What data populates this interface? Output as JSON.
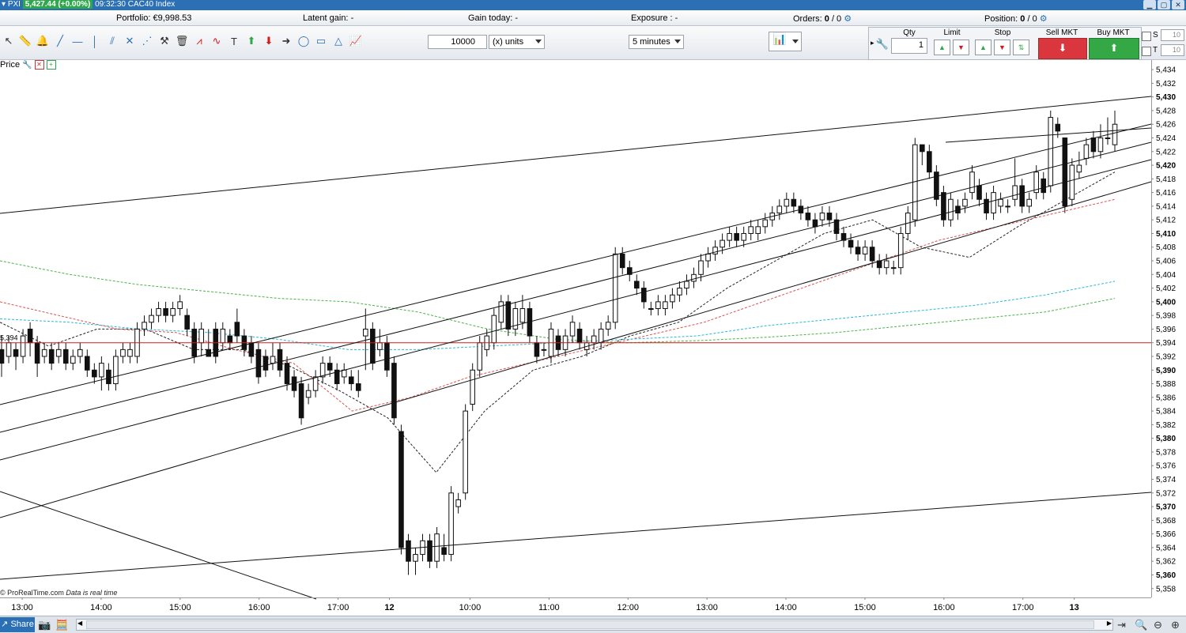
{
  "titlebar": {
    "app": "PXI",
    "price": "5,427.44 (+0.00%)",
    "time": "09:32:30",
    "instrument": "CAC40 Index"
  },
  "statusbar": {
    "portfolio_label": "Portfolio:",
    "portfolio_value": "€9,998.53",
    "latent_label": "Latent gain:",
    "latent_value": "-",
    "gain_today_label": "Gain today:",
    "gain_today_value": "-",
    "exposure_label": "Exposure :",
    "exposure_value": "-",
    "orders_label": "Orders:",
    "orders_value": "0",
    "orders_slash": "/ 0",
    "position_label": "Position:",
    "position_value": "0",
    "position_slash": "/ 0"
  },
  "toolbar": {
    "quantity": "10000",
    "units": "(x) units",
    "interval": "5 minutes"
  },
  "order_panel": {
    "qty_label": "Qty",
    "qty_value": "1",
    "limit_label": "Limit",
    "stop_label": "Stop",
    "sell_label": "Sell MKT",
    "buy_label": "Buy MKT",
    "s_label": "S",
    "s_value": "10",
    "t_label": "T",
    "t_value": "10"
  },
  "chart_header": {
    "label": "Price"
  },
  "watermark": {
    "brand": "© ProRealTime.com",
    "note": "Data is real time"
  },
  "bottom": {
    "share_label": "Share"
  },
  "colors": {
    "accent": "#2b6fb5",
    "sell": "#d9363e",
    "buy": "#33a845",
    "ref_line": "#d11b1b"
  },
  "chart_data": {
    "type": "candlestick",
    "instrument": "CAC40 Index",
    "interval": "5 minutes",
    "ylim": [
      5356.7,
      5435.4
    ],
    "y_ticks": [
      5434,
      5432,
      5430,
      5428,
      5426,
      5424,
      5422,
      5420,
      5418,
      5416,
      5414,
      5412,
      5410,
      5408,
      5406,
      5404,
      5402,
      5400,
      5398,
      5396,
      5394,
      5392,
      5390,
      5388,
      5386,
      5384,
      5382,
      5380,
      5378,
      5376,
      5374,
      5372,
      5370,
      5368,
      5366,
      5364,
      5362,
      5360,
      5358
    ],
    "y_ticks_bold": [
      5430,
      5420,
      5410,
      5400,
      5390,
      5380,
      5370,
      5360
    ],
    "x_ticks": [
      {
        "label": "13:00",
        "x": 0.0
      },
      {
        "label": "14:00",
        "x": 1.0
      },
      {
        "label": "15:00",
        "x": 2.0
      },
      {
        "label": "16:00",
        "x": 3.0
      },
      {
        "label": "17:00",
        "x": 4.0
      },
      {
        "label": "12",
        "x": 4.65,
        "bold": true
      },
      {
        "label": "10:00",
        "x": 5.67
      },
      {
        "label": "11:00",
        "x": 6.67
      },
      {
        "label": "12:00",
        "x": 7.67
      },
      {
        "label": "13:00",
        "x": 8.67
      },
      {
        "label": "14:00",
        "x": 9.67
      },
      {
        "label": "15:00",
        "x": 10.67
      },
      {
        "label": "16:00",
        "x": 11.67
      },
      {
        "label": "17:00",
        "x": 12.67
      },
      {
        "label": "13",
        "x": 13.32,
        "bold": true
      }
    ],
    "reference_line": {
      "value": 5394,
      "label": "5,394"
    },
    "candles": [
      [
        5393,
        5391,
        5395,
        5389
      ],
      [
        5392,
        5394,
        5395,
        5391
      ],
      [
        5393,
        5392,
        5394,
        5390
      ],
      [
        5392,
        5395,
        5396,
        5391
      ],
      [
        5396,
        5394,
        5397,
        5392
      ],
      [
        5394,
        5391,
        5395,
        5389
      ],
      [
        5392,
        5393,
        5394,
        5391
      ],
      [
        5393,
        5391,
        5394,
        5390
      ],
      [
        5392,
        5393,
        5394,
        5391
      ],
      [
        5393,
        5391,
        5394,
        5390
      ],
      [
        5391,
        5392,
        5393,
        5390
      ],
      [
        5392,
        5393,
        5394,
        5391
      ],
      [
        5392,
        5390,
        5393,
        5389
      ],
      [
        5390,
        5389,
        5391,
        5388
      ],
      [
        5389,
        5391,
        5392,
        5387
      ],
      [
        5390,
        5388,
        5391,
        5387
      ],
      [
        5388,
        5392,
        5393,
        5387
      ],
      [
        5392,
        5393,
        5394,
        5391
      ],
      [
        5392,
        5393,
        5394,
        5391
      ],
      [
        5392,
        5396,
        5397,
        5391
      ],
      [
        5396,
        5397,
        5398,
        5395
      ],
      [
        5397,
        5398,
        5399,
        5396
      ],
      [
        5398,
        5399,
        5400,
        5397
      ],
      [
        5399,
        5398,
        5400,
        5397
      ],
      [
        5398,
        5399,
        5400,
        5397
      ],
      [
        5399,
        5400,
        5401,
        5398
      ],
      [
        5398,
        5396,
        5399,
        5395
      ],
      [
        5396,
        5392,
        5397,
        5391
      ],
      [
        5394,
        5396,
        5397,
        5392
      ],
      [
        5393,
        5392,
        5396,
        5392
      ],
      [
        5396,
        5392,
        5397,
        5391
      ],
      [
        5394,
        5396,
        5397,
        5393
      ],
      [
        5395,
        5394,
        5396,
        5393
      ],
      [
        5397,
        5395,
        5399,
        5394
      ],
      [
        5395,
        5393,
        5396,
        5392
      ],
      [
        5394,
        5392,
        5395,
        5391
      ],
      [
        5393,
        5389,
        5394,
        5388
      ],
      [
        5392,
        5390,
        5393,
        5389
      ],
      [
        5391,
        5392,
        5394,
        5390
      ],
      [
        5393,
        5390,
        5394,
        5389
      ],
      [
        5391,
        5388,
        5392,
        5387
      ],
      [
        5389,
        5387,
        5390,
        5386
      ],
      [
        5388,
        5383,
        5389,
        5382
      ],
      [
        5386,
        5387,
        5388,
        5385
      ],
      [
        5387,
        5389,
        5390,
        5386
      ],
      [
        5389,
        5391,
        5392,
        5388
      ],
      [
        5391,
        5390,
        5392,
        5389
      ],
      [
        5390,
        5388,
        5391,
        5387
      ],
      [
        5389,
        5390,
        5391,
        5388
      ],
      [
        5389,
        5388,
        5390,
        5387
      ],
      [
        5388,
        5387,
        5390,
        5386
      ],
      [
        5395,
        5396,
        5399,
        5390
      ],
      [
        5396,
        5391,
        5397,
        5390
      ],
      [
        5393,
        5394,
        5396,
        5392
      ],
      [
        5394,
        5390,
        5395,
        5389
      ],
      [
        5391,
        5383,
        5392,
        5382
      ],
      [
        5381,
        5364,
        5382,
        5363
      ],
      [
        5365,
        5362,
        5366,
        5360
      ],
      [
        5362,
        5363,
        5364,
        5360
      ],
      [
        5363,
        5365,
        5366,
        5362
      ],
      [
        5365,
        5362,
        5366,
        5361
      ],
      [
        5362,
        5366,
        5367,
        5361
      ],
      [
        5364,
        5363,
        5366,
        5362
      ],
      [
        5363,
        5372,
        5373,
        5362
      ],
      [
        5370,
        5371,
        5372,
        5369
      ],
      [
        5372,
        5384,
        5385,
        5371
      ],
      [
        5385,
        5390,
        5391,
        5384
      ],
      [
        5390,
        5394,
        5395,
        5389
      ],
      [
        5393,
        5395,
        5396,
        5392
      ],
      [
        5394,
        5398,
        5399,
        5393
      ],
      [
        5397,
        5400,
        5401,
        5396
      ],
      [
        5400,
        5396,
        5401,
        5395
      ],
      [
        5396,
        5399,
        5400,
        5395
      ],
      [
        5397,
        5399,
        5401,
        5396
      ],
      [
        5399,
        5395,
        5400,
        5394
      ],
      [
        5394,
        5392,
        5395,
        5391
      ],
      [
        5393,
        5393,
        5394,
        5392
      ],
      [
        5392,
        5396,
        5397,
        5391
      ],
      [
        5395,
        5393,
        5396,
        5392
      ],
      [
        5393,
        5395,
        5396,
        5392
      ],
      [
        5395,
        5397,
        5398,
        5394
      ],
      [
        5396,
        5394,
        5397,
        5393
      ],
      [
        5393,
        5394,
        5395,
        5392
      ],
      [
        5394,
        5395,
        5396,
        5393
      ],
      [
        5394,
        5396,
        5397,
        5393
      ],
      [
        5396,
        5397,
        5398,
        5395
      ],
      [
        5397,
        5407,
        5408,
        5396
      ],
      [
        5407,
        5405,
        5408,
        5404
      ],
      [
        5405,
        5404,
        5406,
        5403
      ],
      [
        5403,
        5402,
        5404,
        5401
      ],
      [
        5402,
        5400,
        5403,
        5399
      ],
      [
        5399,
        5399,
        5400,
        5398
      ],
      [
        5399,
        5400,
        5401,
        5398
      ],
      [
        5399,
        5400,
        5401,
        5398
      ],
      [
        5400,
        5401,
        5402,
        5399
      ],
      [
        5401,
        5402,
        5403,
        5400
      ],
      [
        5402,
        5403,
        5404,
        5401
      ],
      [
        5403,
        5404,
        5405,
        5402
      ],
      [
        5404,
        5406,
        5407,
        5403
      ],
      [
        5406,
        5407,
        5408,
        5405
      ],
      [
        5407,
        5408,
        5409,
        5406
      ],
      [
        5408,
        5409,
        5410,
        5407
      ],
      [
        5409,
        5410,
        5411,
        5408
      ],
      [
        5410,
        5409,
        5411,
        5408
      ],
      [
        5409,
        5410,
        5411,
        5408
      ],
      [
        5410,
        5411,
        5412,
        5409
      ],
      [
        5410,
        5411,
        5412,
        5409
      ],
      [
        5411,
        5412,
        5413,
        5410
      ],
      [
        5412,
        5413,
        5414,
        5411
      ],
      [
        5413,
        5414,
        5415,
        5412
      ],
      [
        5414,
        5415,
        5416,
        5413
      ],
      [
        5415,
        5414,
        5416,
        5413
      ],
      [
        5414,
        5413,
        5415,
        5412
      ],
      [
        5413,
        5412,
        5414,
        5411
      ],
      [
        5412,
        5411,
        5413,
        5410
      ],
      [
        5412,
        5413,
        5414,
        5411
      ],
      [
        5413,
        5412,
        5414,
        5411
      ],
      [
        5412,
        5410,
        5413,
        5409
      ],
      [
        5410,
        5409,
        5411,
        5408
      ],
      [
        5409,
        5408,
        5410,
        5407
      ],
      [
        5408,
        5407,
        5409,
        5406
      ],
      [
        5407,
        5408,
        5409,
        5406
      ],
      [
        5408,
        5406,
        5409,
        5405
      ],
      [
        5406,
        5405,
        5407,
        5404
      ],
      [
        5405,
        5406,
        5407,
        5404
      ],
      [
        5405,
        5405,
        5406,
        5404
      ],
      [
        5405,
        5410,
        5411,
        5404
      ],
      [
        5410,
        5413,
        5414,
        5409
      ],
      [
        5412,
        5423,
        5424,
        5411
      ],
      [
        5423,
        5422,
        5423,
        5420
      ],
      [
        5422,
        5419,
        5423,
        5418
      ],
      [
        5419,
        5415,
        5420,
        5414
      ],
      [
        5416,
        5412,
        5417,
        5411
      ],
      [
        5412,
        5415,
        5416,
        5411
      ],
      [
        5414,
        5413,
        5415,
        5412
      ],
      [
        5414,
        5415,
        5416,
        5413
      ],
      [
        5416,
        5419,
        5420,
        5415
      ],
      [
        5417,
        5415,
        5418,
        5414
      ],
      [
        5415,
        5413,
        5416,
        5412
      ],
      [
        5413,
        5416,
        5417,
        5412
      ],
      [
        5414,
        5415,
        5416,
        5413
      ],
      [
        5414,
        5414,
        5415,
        5413
      ],
      [
        5415,
        5417,
        5421,
        5414
      ],
      [
        5417,
        5414,
        5418,
        5413
      ],
      [
        5414,
        5415,
        5416,
        5413
      ],
      [
        5416,
        5419,
        5420,
        5415
      ],
      [
        5418,
        5416,
        5419,
        5415
      ],
      [
        5417,
        5427,
        5428,
        5416
      ],
      [
        5426,
        5425,
        5427,
        5424
      ],
      [
        5424,
        5414,
        5419,
        5413
      ],
      [
        5415,
        5420,
        5421,
        5414
      ],
      [
        5419,
        5420,
        5422,
        5418
      ],
      [
        5421,
        5423,
        5424,
        5420
      ],
      [
        5424,
        5422,
        5425,
        5421
      ],
      [
        5422,
        5424,
        5426,
        5421
      ],
      [
        5424,
        5424,
        5427,
        5423
      ],
      [
        5423,
        5426,
        5428,
        5422
      ]
    ],
    "moving_averages": [
      {
        "name": "MA-black",
        "color": "#222222",
        "values": [
          [
            0,
            5397
          ],
          [
            1,
            5393.5
          ],
          [
            2,
            5396
          ],
          [
            3,
            5396
          ],
          [
            4,
            5393
          ],
          [
            5,
            5393
          ],
          [
            6,
            5390.5
          ],
          [
            7,
            5387
          ],
          [
            8,
            5383
          ],
          [
            9,
            5375
          ],
          [
            10,
            5384
          ],
          [
            11,
            5390
          ],
          [
            12,
            5392
          ],
          [
            13,
            5395
          ],
          [
            14,
            5397
          ],
          [
            15,
            5402
          ],
          [
            16,
            5406
          ],
          [
            17,
            5410
          ],
          [
            18,
            5412
          ],
          [
            19,
            5408
          ],
          [
            20,
            5406.5
          ],
          [
            21,
            5411
          ],
          [
            22,
            5415
          ],
          [
            23,
            5419
          ]
        ]
      },
      {
        "name": "MA-red",
        "color": "#d9534f",
        "values": [
          [
            0,
            5400
          ],
          [
            1,
            5398
          ],
          [
            2,
            5396
          ],
          [
            3,
            5395.5
          ],
          [
            4,
            5393
          ],
          [
            5,
            5391
          ],
          [
            6,
            5384
          ],
          [
            7,
            5386
          ],
          [
            8,
            5389
          ],
          [
            9,
            5391
          ],
          [
            10,
            5393
          ],
          [
            11,
            5395
          ],
          [
            12,
            5397
          ],
          [
            13,
            5400
          ],
          [
            14,
            5403
          ],
          [
            15,
            5406
          ],
          [
            16,
            5409
          ],
          [
            17,
            5411
          ],
          [
            18,
            5413
          ],
          [
            19,
            5415
          ]
        ]
      },
      {
        "name": "MA-cyan",
        "color": "#2ab7d8",
        "values": [
          [
            0,
            5397.5
          ],
          [
            1,
            5397
          ],
          [
            2,
            5396
          ],
          [
            3,
            5395.5
          ],
          [
            4,
            5394.5
          ],
          [
            5,
            5393
          ],
          [
            6,
            5393
          ],
          [
            7,
            5393.5
          ],
          [
            8,
            5394
          ],
          [
            9,
            5394.5
          ],
          [
            10,
            5395
          ],
          [
            11,
            5396.5
          ],
          [
            12,
            5397.5
          ],
          [
            13,
            5398.5
          ],
          [
            14,
            5399.5
          ],
          [
            15,
            5401
          ],
          [
            16,
            5403
          ]
        ]
      },
      {
        "name": "MA-green",
        "color": "#49b34a",
        "values": [
          [
            0,
            5406
          ],
          [
            1,
            5404
          ],
          [
            2,
            5402.5
          ],
          [
            3,
            5401.5
          ],
          [
            4,
            5400.5
          ],
          [
            5,
            5400
          ],
          [
            6,
            5398.5
          ],
          [
            7,
            5396
          ],
          [
            8,
            5394.5
          ],
          [
            9,
            5394
          ],
          [
            10,
            5394.3
          ],
          [
            11,
            5394.8
          ],
          [
            12,
            5395.5
          ],
          [
            13,
            5396.5
          ],
          [
            14,
            5397.5
          ],
          [
            15,
            5398.5
          ],
          [
            16,
            5400.5
          ]
        ]
      }
    ]
  }
}
